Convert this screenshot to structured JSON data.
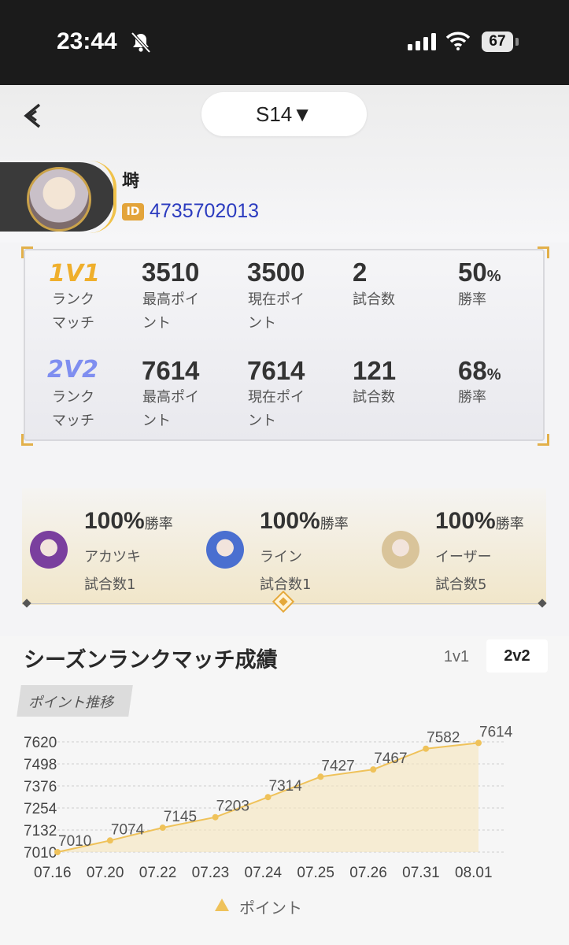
{
  "status_bar": {
    "time": "23:44",
    "battery": "67"
  },
  "header": {
    "season": "S14▼"
  },
  "profile": {
    "name": "塒",
    "id_badge": "ID",
    "id": "4735702013"
  },
  "ranked": [
    {
      "mode": "1V1",
      "label": [
        "ランク",
        "マッチ"
      ],
      "best_points": "3510",
      "best_label": [
        "最高ポイ",
        "ント"
      ],
      "current_points": "3500",
      "current_label": [
        "現在ポイ",
        "ント"
      ],
      "matches": "2",
      "matches_label": "試合数",
      "win_rate": "50",
      "win_rate_unit": "%",
      "win_label": "勝率"
    },
    {
      "mode": "2V2",
      "label": [
        "ランク",
        "マッチ"
      ],
      "best_points": "7614",
      "best_label": [
        "最高ポイ",
        "ント"
      ],
      "current_points": "7614",
      "current_label": [
        "現在ポイ",
        "ント"
      ],
      "matches": "121",
      "matches_label": "試合数",
      "win_rate": "68",
      "win_rate_unit": "%",
      "win_label": "勝率"
    }
  ],
  "characters": [
    {
      "win_rate": "100%",
      "suffix": "勝率",
      "name": "アカツキ",
      "matches": "試合数1",
      "color": "#7a3f9e"
    },
    {
      "win_rate": "100%",
      "suffix": "勝率",
      "name": "ライン",
      "matches": "試合数1",
      "color": "#4a6fd0"
    },
    {
      "win_rate": "100%",
      "suffix": "勝率",
      "name": "イーザー",
      "matches": "試合数5",
      "color": "#d9c49a"
    }
  ],
  "section": {
    "title": "シーズンランクマッチ成績",
    "tab_1v1": "1v1",
    "tab_2v2": "2v2",
    "active_tab": "2v2",
    "chart_tag": "ポイント推移"
  },
  "chart_data": {
    "type": "area",
    "categories": [
      "07.16",
      "07.20",
      "07.22",
      "07.23",
      "07.24",
      "07.25",
      "07.26",
      "07.31",
      "08.01"
    ],
    "series": [
      {
        "name": "ポイント",
        "values": [
          7010,
          7074,
          7145,
          7203,
          7314,
          7427,
          7467,
          7582,
          7614
        ]
      }
    ],
    "yticks": [
      7620,
      7498,
      7376,
      7254,
      7132,
      7010
    ],
    "ylim": [
      7010,
      7620
    ],
    "color": "#efc25a"
  }
}
